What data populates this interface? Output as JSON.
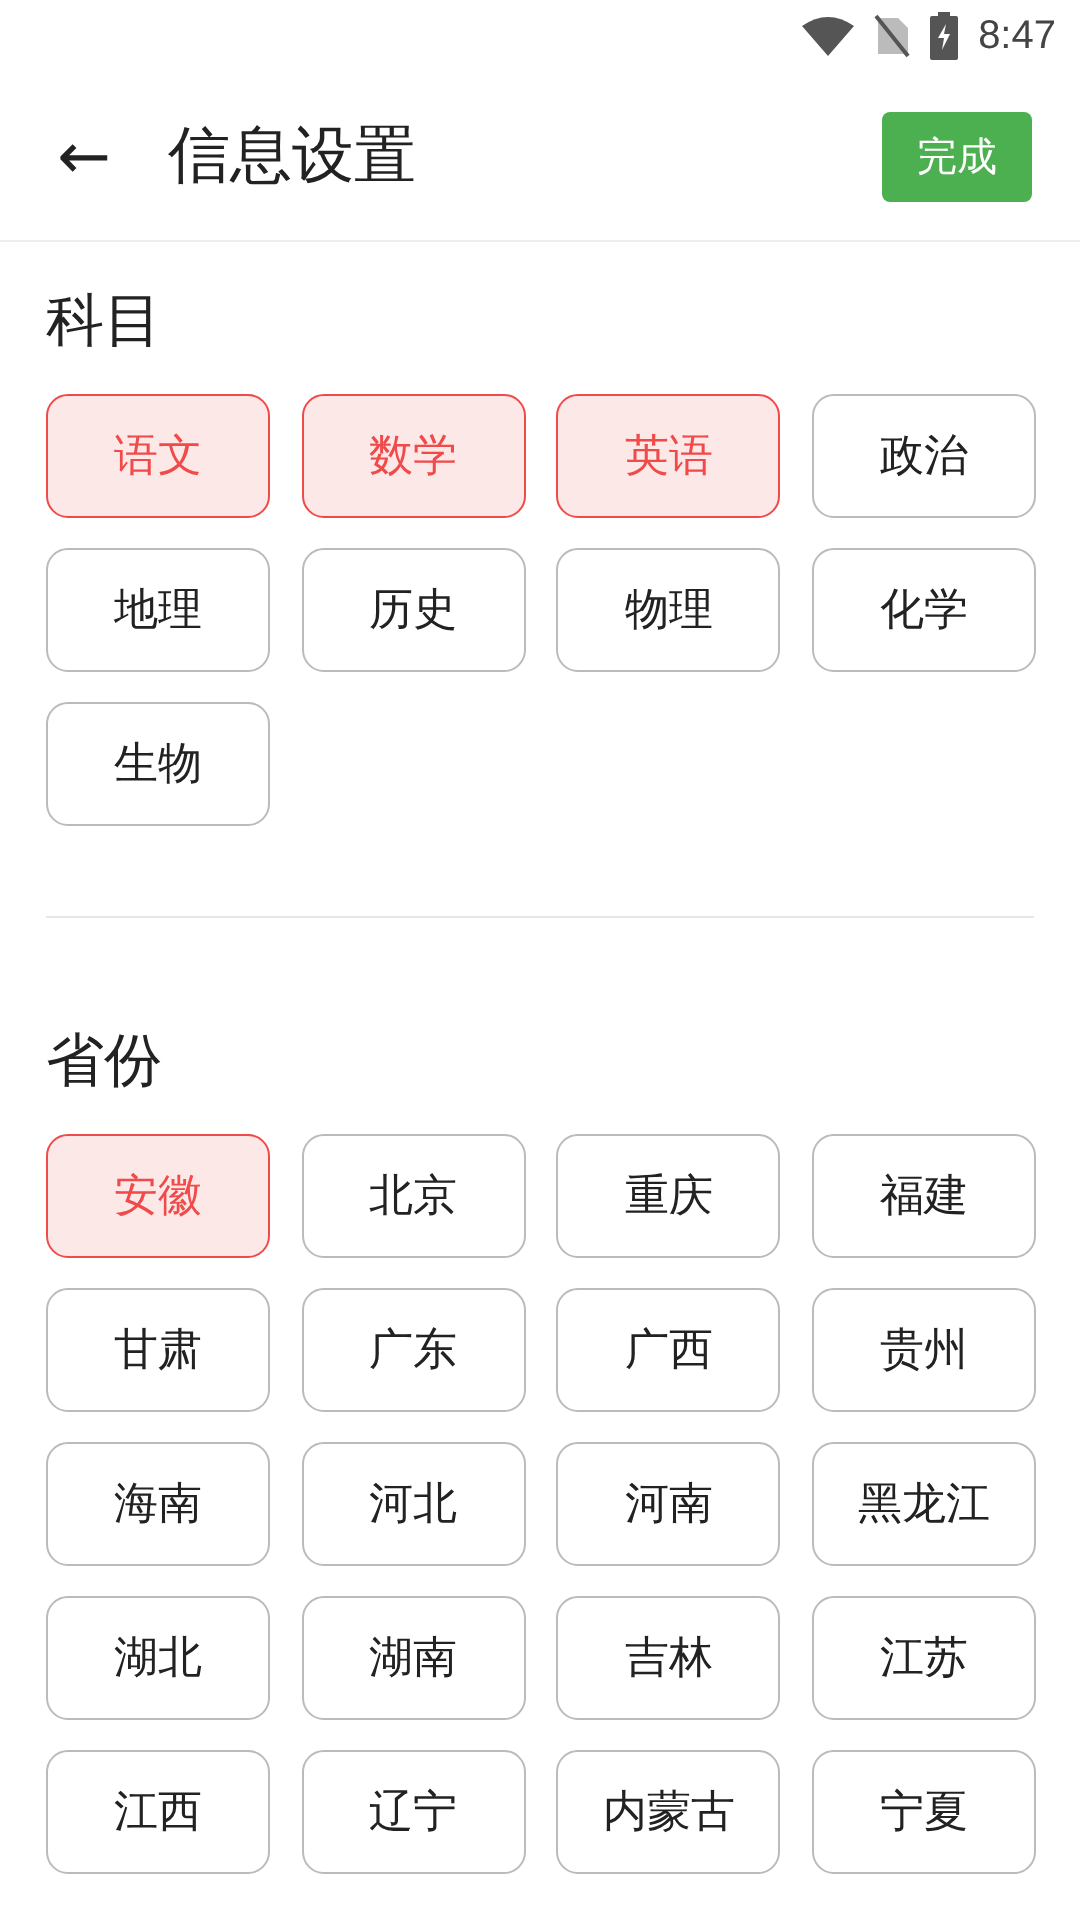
{
  "status_bar": {
    "time": "8:47"
  },
  "header": {
    "back": "←",
    "title": "信息设置",
    "done_button": "完成"
  },
  "sections": [
    {
      "title": "科目",
      "options": [
        {
          "label": "语文",
          "selected": true
        },
        {
          "label": "数学",
          "selected": true
        },
        {
          "label": "英语",
          "selected": true
        },
        {
          "label": "政治",
          "selected": false
        },
        {
          "label": "地理",
          "selected": false
        },
        {
          "label": "历史",
          "selected": false
        },
        {
          "label": "物理",
          "selected": false
        },
        {
          "label": "化学",
          "selected": false
        },
        {
          "label": "生物",
          "selected": false
        }
      ]
    },
    {
      "title": "省份",
      "options": [
        {
          "label": "安徽",
          "selected": true
        },
        {
          "label": "北京",
          "selected": false
        },
        {
          "label": "重庆",
          "selected": false
        },
        {
          "label": "福建",
          "selected": false
        },
        {
          "label": "甘肃",
          "selected": false
        },
        {
          "label": "广东",
          "selected": false
        },
        {
          "label": "广西",
          "selected": false
        },
        {
          "label": "贵州",
          "selected": false
        },
        {
          "label": "海南",
          "selected": false
        },
        {
          "label": "河北",
          "selected": false
        },
        {
          "label": "河南",
          "selected": false
        },
        {
          "label": "黑龙江",
          "selected": false
        },
        {
          "label": "湖北",
          "selected": false
        },
        {
          "label": "湖南",
          "selected": false
        },
        {
          "label": "吉林",
          "selected": false
        },
        {
          "label": "江苏",
          "selected": false
        },
        {
          "label": "江西",
          "selected": false
        },
        {
          "label": "辽宁",
          "selected": false
        },
        {
          "label": "内蒙古",
          "selected": false
        },
        {
          "label": "宁夏",
          "selected": false
        }
      ]
    }
  ]
}
